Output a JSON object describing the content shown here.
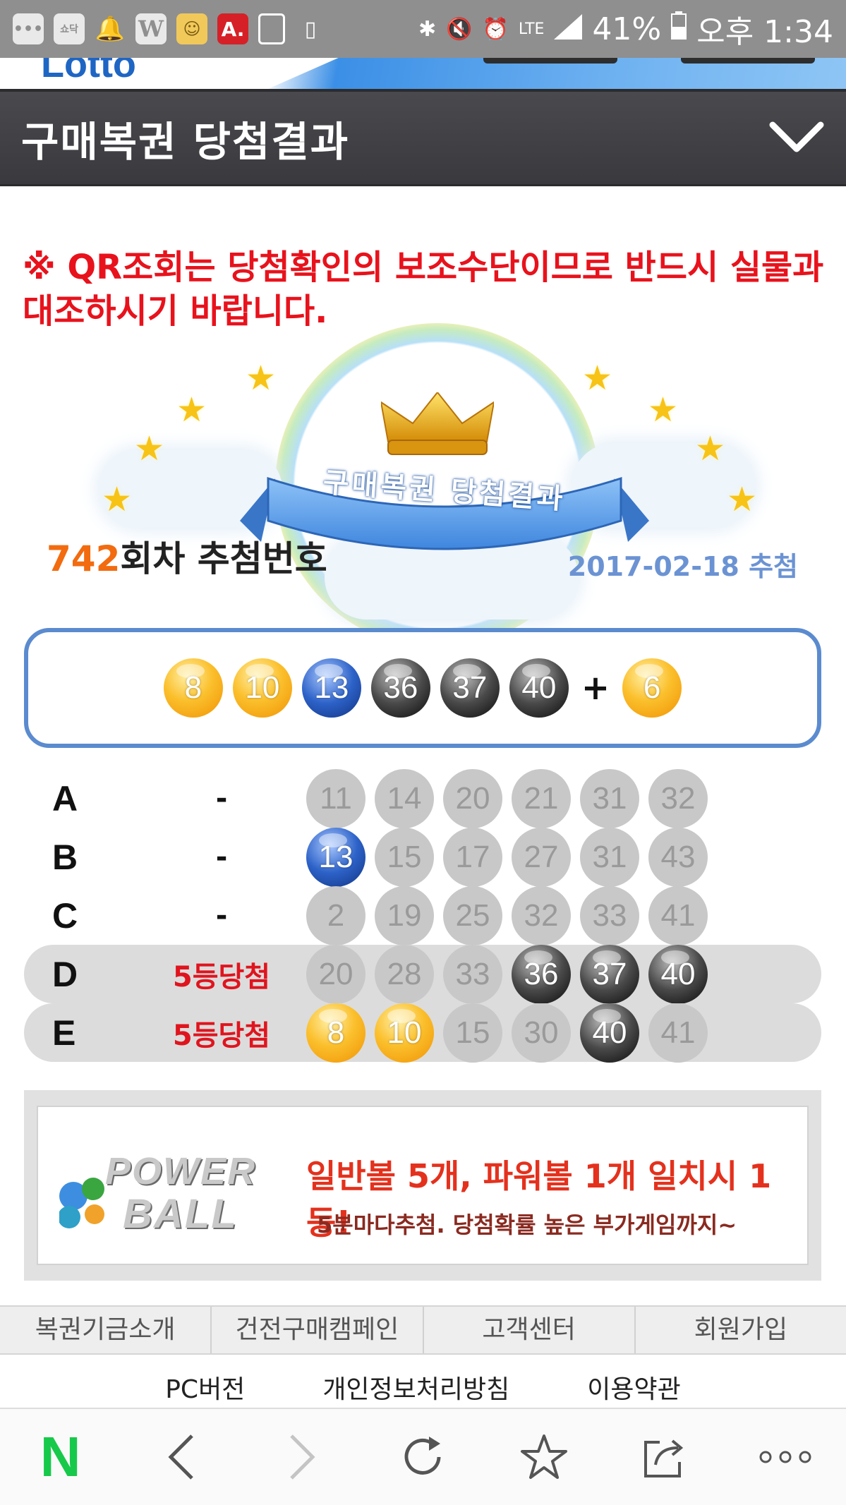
{
  "status_bar": {
    "icons": [
      "chat-icon",
      "shop-icon",
      "bell-icon",
      "w-app-icon",
      "character-icon",
      "acrobat-icon",
      "gallery-icon",
      "screen-icon",
      "bluetooth-icon",
      "mute-icon",
      "alarm-icon",
      "lte-icon",
      "signal-icon"
    ],
    "shop_label": "쇼닥",
    "w_label": "W",
    "a_label": "A.",
    "lte": "LTE",
    "battery": "41%",
    "time": "오후 1:34"
  },
  "header": {
    "title": "구매복권 당첨결과",
    "chevron": "chevron-down-icon"
  },
  "notice": "※ QR조회는 당첨확인의 보조수단이므로 반드시 실물과 대조하시기 바랍니다.",
  "banner": {
    "ribbon_text": "구매복권 당첨결과"
  },
  "draw": {
    "round": "742",
    "round_suffix": "회차 추첨번호",
    "date": "2017-02-18 추첨",
    "numbers": [
      {
        "n": "8",
        "color": "yellow"
      },
      {
        "n": "10",
        "color": "yellow"
      },
      {
        "n": "13",
        "color": "blue"
      },
      {
        "n": "36",
        "color": "dark"
      },
      {
        "n": "37",
        "color": "dark"
      },
      {
        "n": "40",
        "color": "dark"
      }
    ],
    "plus": "+",
    "bonus": {
      "n": "6",
      "color": "yellow"
    }
  },
  "tickets": [
    {
      "label": "A",
      "result": "-",
      "win": false,
      "numbers": [
        {
          "n": "11",
          "color": "gray"
        },
        {
          "n": "14",
          "color": "gray"
        },
        {
          "n": "20",
          "color": "gray"
        },
        {
          "n": "21",
          "color": "gray"
        },
        {
          "n": "31",
          "color": "gray"
        },
        {
          "n": "32",
          "color": "gray"
        }
      ]
    },
    {
      "label": "B",
      "result": "-",
      "win": false,
      "numbers": [
        {
          "n": "13",
          "color": "blue"
        },
        {
          "n": "15",
          "color": "gray"
        },
        {
          "n": "17",
          "color": "gray"
        },
        {
          "n": "27",
          "color": "gray"
        },
        {
          "n": "31",
          "color": "gray"
        },
        {
          "n": "43",
          "color": "gray"
        }
      ]
    },
    {
      "label": "C",
      "result": "-",
      "win": false,
      "numbers": [
        {
          "n": "2",
          "color": "gray"
        },
        {
          "n": "19",
          "color": "gray"
        },
        {
          "n": "25",
          "color": "gray"
        },
        {
          "n": "32",
          "color": "gray"
        },
        {
          "n": "33",
          "color": "gray"
        },
        {
          "n": "41",
          "color": "gray"
        }
      ]
    },
    {
      "label": "D",
      "result": "5등당첨",
      "win": true,
      "numbers": [
        {
          "n": "20",
          "color": "gray"
        },
        {
          "n": "28",
          "color": "gray"
        },
        {
          "n": "33",
          "color": "gray"
        },
        {
          "n": "36",
          "color": "dark"
        },
        {
          "n": "37",
          "color": "dark"
        },
        {
          "n": "40",
          "color": "dark"
        }
      ]
    },
    {
      "label": "E",
      "result": "5등당첨",
      "win": true,
      "numbers": [
        {
          "n": "8",
          "color": "yellow"
        },
        {
          "n": "10",
          "color": "yellow"
        },
        {
          "n": "15",
          "color": "gray"
        },
        {
          "n": "30",
          "color": "gray"
        },
        {
          "n": "40",
          "color": "dark"
        },
        {
          "n": "41",
          "color": "gray"
        }
      ]
    }
  ],
  "ad": {
    "logo_top": "POWER",
    "logo_bottom": "BALL",
    "headline": "일반볼 5개, 파워볼 1개 일치시 1등!",
    "subline": "5분마다추첨. 당첨확률 높은 부가게임까지~"
  },
  "footer_nav": [
    "복권기금소개",
    "건전구매캠페인",
    "고객센터",
    "회원가입"
  ],
  "footer_links": [
    "PC버전",
    "개인정보처리방침",
    "이용약관"
  ],
  "toolbar": {
    "n_label": "N",
    "items": [
      "naver-home-icon",
      "back-icon",
      "forward-icon",
      "reload-icon",
      "bookmark-star-icon",
      "share-icon",
      "more-icon"
    ]
  },
  "colors": {
    "title_bar": "#3f3e43",
    "notice_red": "#e8121c",
    "round_orange": "#f26b0f",
    "date_blue": "#6b93d3",
    "win_border": "#5b8bcf",
    "win_text": "#e0141e",
    "naver_green": "#17c94a"
  }
}
